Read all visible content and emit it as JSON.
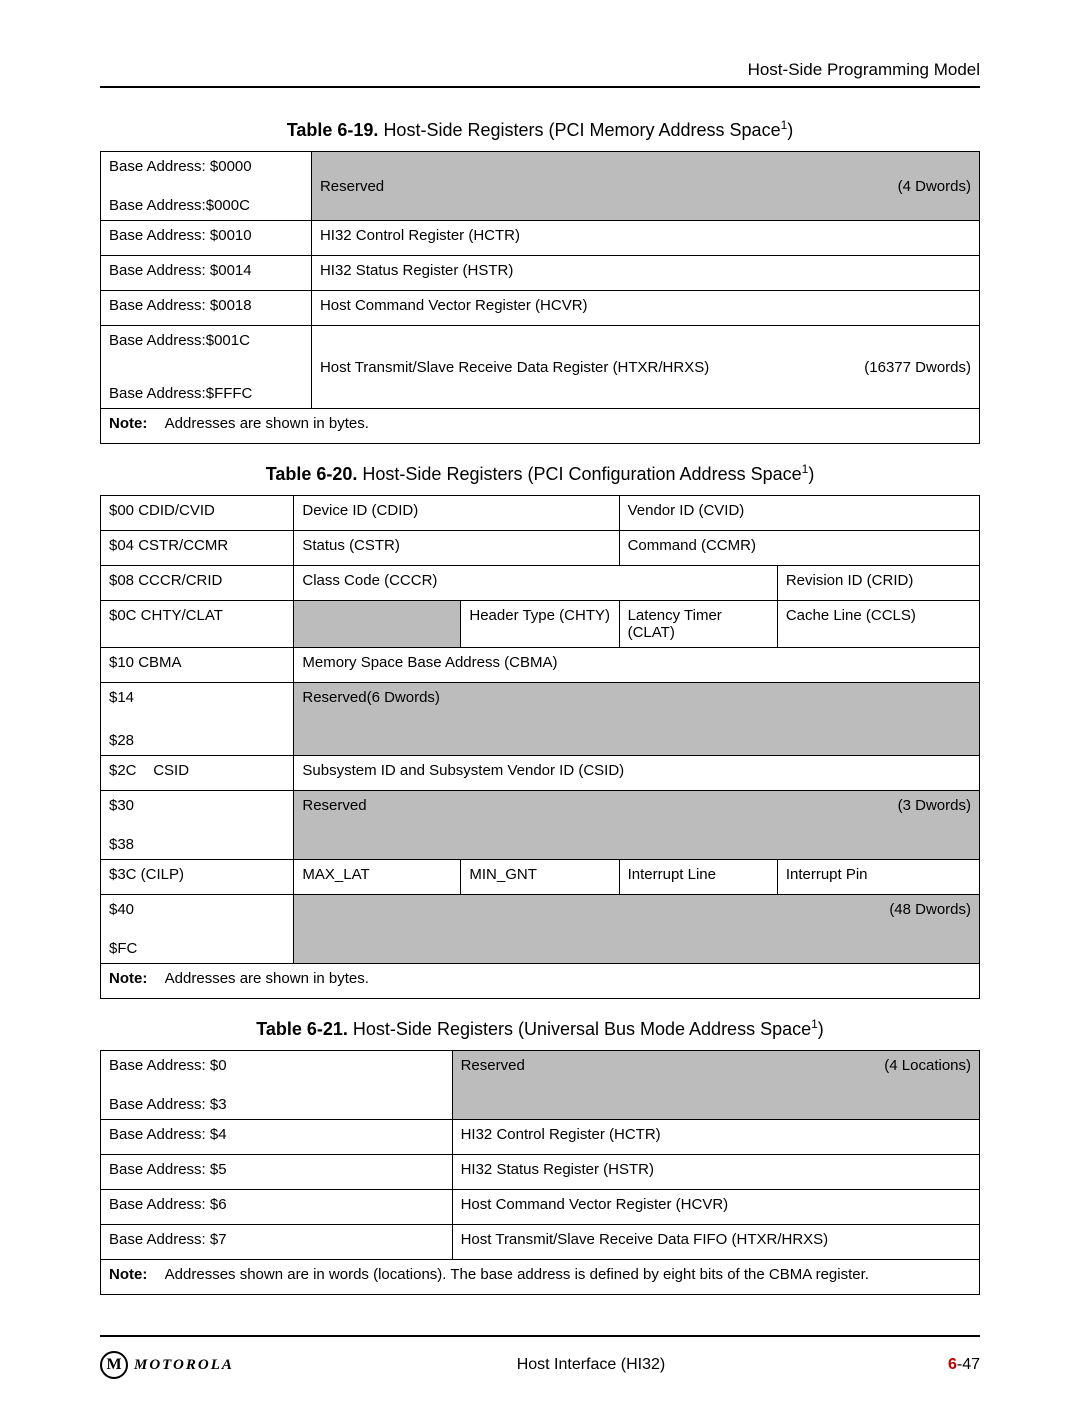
{
  "header": {
    "section": "Host-Side Programming Model"
  },
  "captions": {
    "t19": {
      "label": "Table 6-19. ",
      "title": "Host-Side Registers (PCI Memory Address Space",
      "sup": "1",
      "close": ")"
    },
    "t20": {
      "label": "Table 6-20. ",
      "title": "Host-Side Registers (PCI Configuration Address Space",
      "sup": "1",
      "close": ")"
    },
    "t21": {
      "label": "Table 6-21. ",
      "title": "Host-Side Registers (Universal Bus Mode Address Space",
      "sup": "1",
      "close": ")"
    }
  },
  "t19": {
    "r1a": "Base Address: $0000",
    "r1b": "Base Address:$000C",
    "r1_desc": "Reserved",
    "r1_right": "(4 Dwords)",
    "r2a": "Base Address: $0010",
    "r2b": "HI32 Control Register (HCTR)",
    "r3a": "Base Address: $0014",
    "r3b": "HI32 Status Register (HSTR)",
    "r4a": "Base Address: $0018",
    "r4b": "Host Command Vector Register (HCVR)",
    "r5a": "Base Address:$001C",
    "r5b": "Base Address:$FFFC",
    "r5_desc": "Host Transmit/Slave Receive Data Register (HTXR/HRXS)",
    "r5_right": "(16377 Dwords)",
    "note_label": "Note:",
    "note_text": "Addresses are shown in bytes."
  },
  "t20": {
    "r1a": "$00 CDID/CVID",
    "r1b": "Device ID (CDID)",
    "r1c": "Vendor ID (CVID)",
    "r2a": "$04 CSTR/CCMR",
    "r2b": "Status (CSTR)",
    "r2c": "Command (CCMR)",
    "r3a": "$08 CCCR/CRID",
    "r3b": "Class Code (CCCR)",
    "r3c": "Revision ID (CRID)",
    "r4a": "$0C CHTY/CLAT",
    "r4b": "",
    "r4c": "Header Type (CHTY)",
    "r4d": "Latency Timer (CLAT)",
    "r4e": "Cache Line (CCLS)",
    "r5a": "$10 CBMA",
    "r5b": "Memory Space Base Address (CBMA)",
    "r6a": "$14",
    "r6b": "$28",
    "r6_desc": "Reserved(6 Dwords)",
    "r7a": "$2C",
    "r7a2": "CSID",
    "r7b": "Subsystem ID and Subsystem Vendor ID (CSID)",
    "r8a": "$30",
    "r8b": "$38",
    "r8_desc": "Reserved",
    "r8_right": "(3 Dwords)",
    "r9a": "$3C (CILP)",
    "r9b": "MAX_LAT",
    "r9c": "MIN_GNT",
    "r9d": "Interrupt Line",
    "r9e": "Interrupt Pin",
    "r10a": "$40",
    "r10b": "$FC",
    "r10_right": "(48 Dwords)",
    "note_label": "Note:",
    "note_text": "Addresses are shown in bytes."
  },
  "t21": {
    "r1a": "Base Address: $0",
    "r1b": "Base Address: $3",
    "r1_desc": "Reserved",
    "r1_right": "(4 Locations)",
    "r2a": "Base Address: $4",
    "r2b": "HI32 Control Register (HCTR)",
    "r3a": "Base Address: $5",
    "r3b": "HI32 Status Register (HSTR)",
    "r4a": "Base Address: $6",
    "r4b": "Host Command Vector Register (HCVR)",
    "r5a": "Base Address: $7",
    "r5b": "Host Transmit/Slave Receive Data FIFO (HTXR/HRXS)",
    "note_label": "Note:",
    "note_text": "Addresses shown are in words (locations). The base address is defined by eight bits of the CBMA register."
  },
  "footer": {
    "brand": "MOTOROLA",
    "center": "Host Interface (HI32)",
    "chap": "6",
    "sep": "-",
    "pg": "47"
  }
}
